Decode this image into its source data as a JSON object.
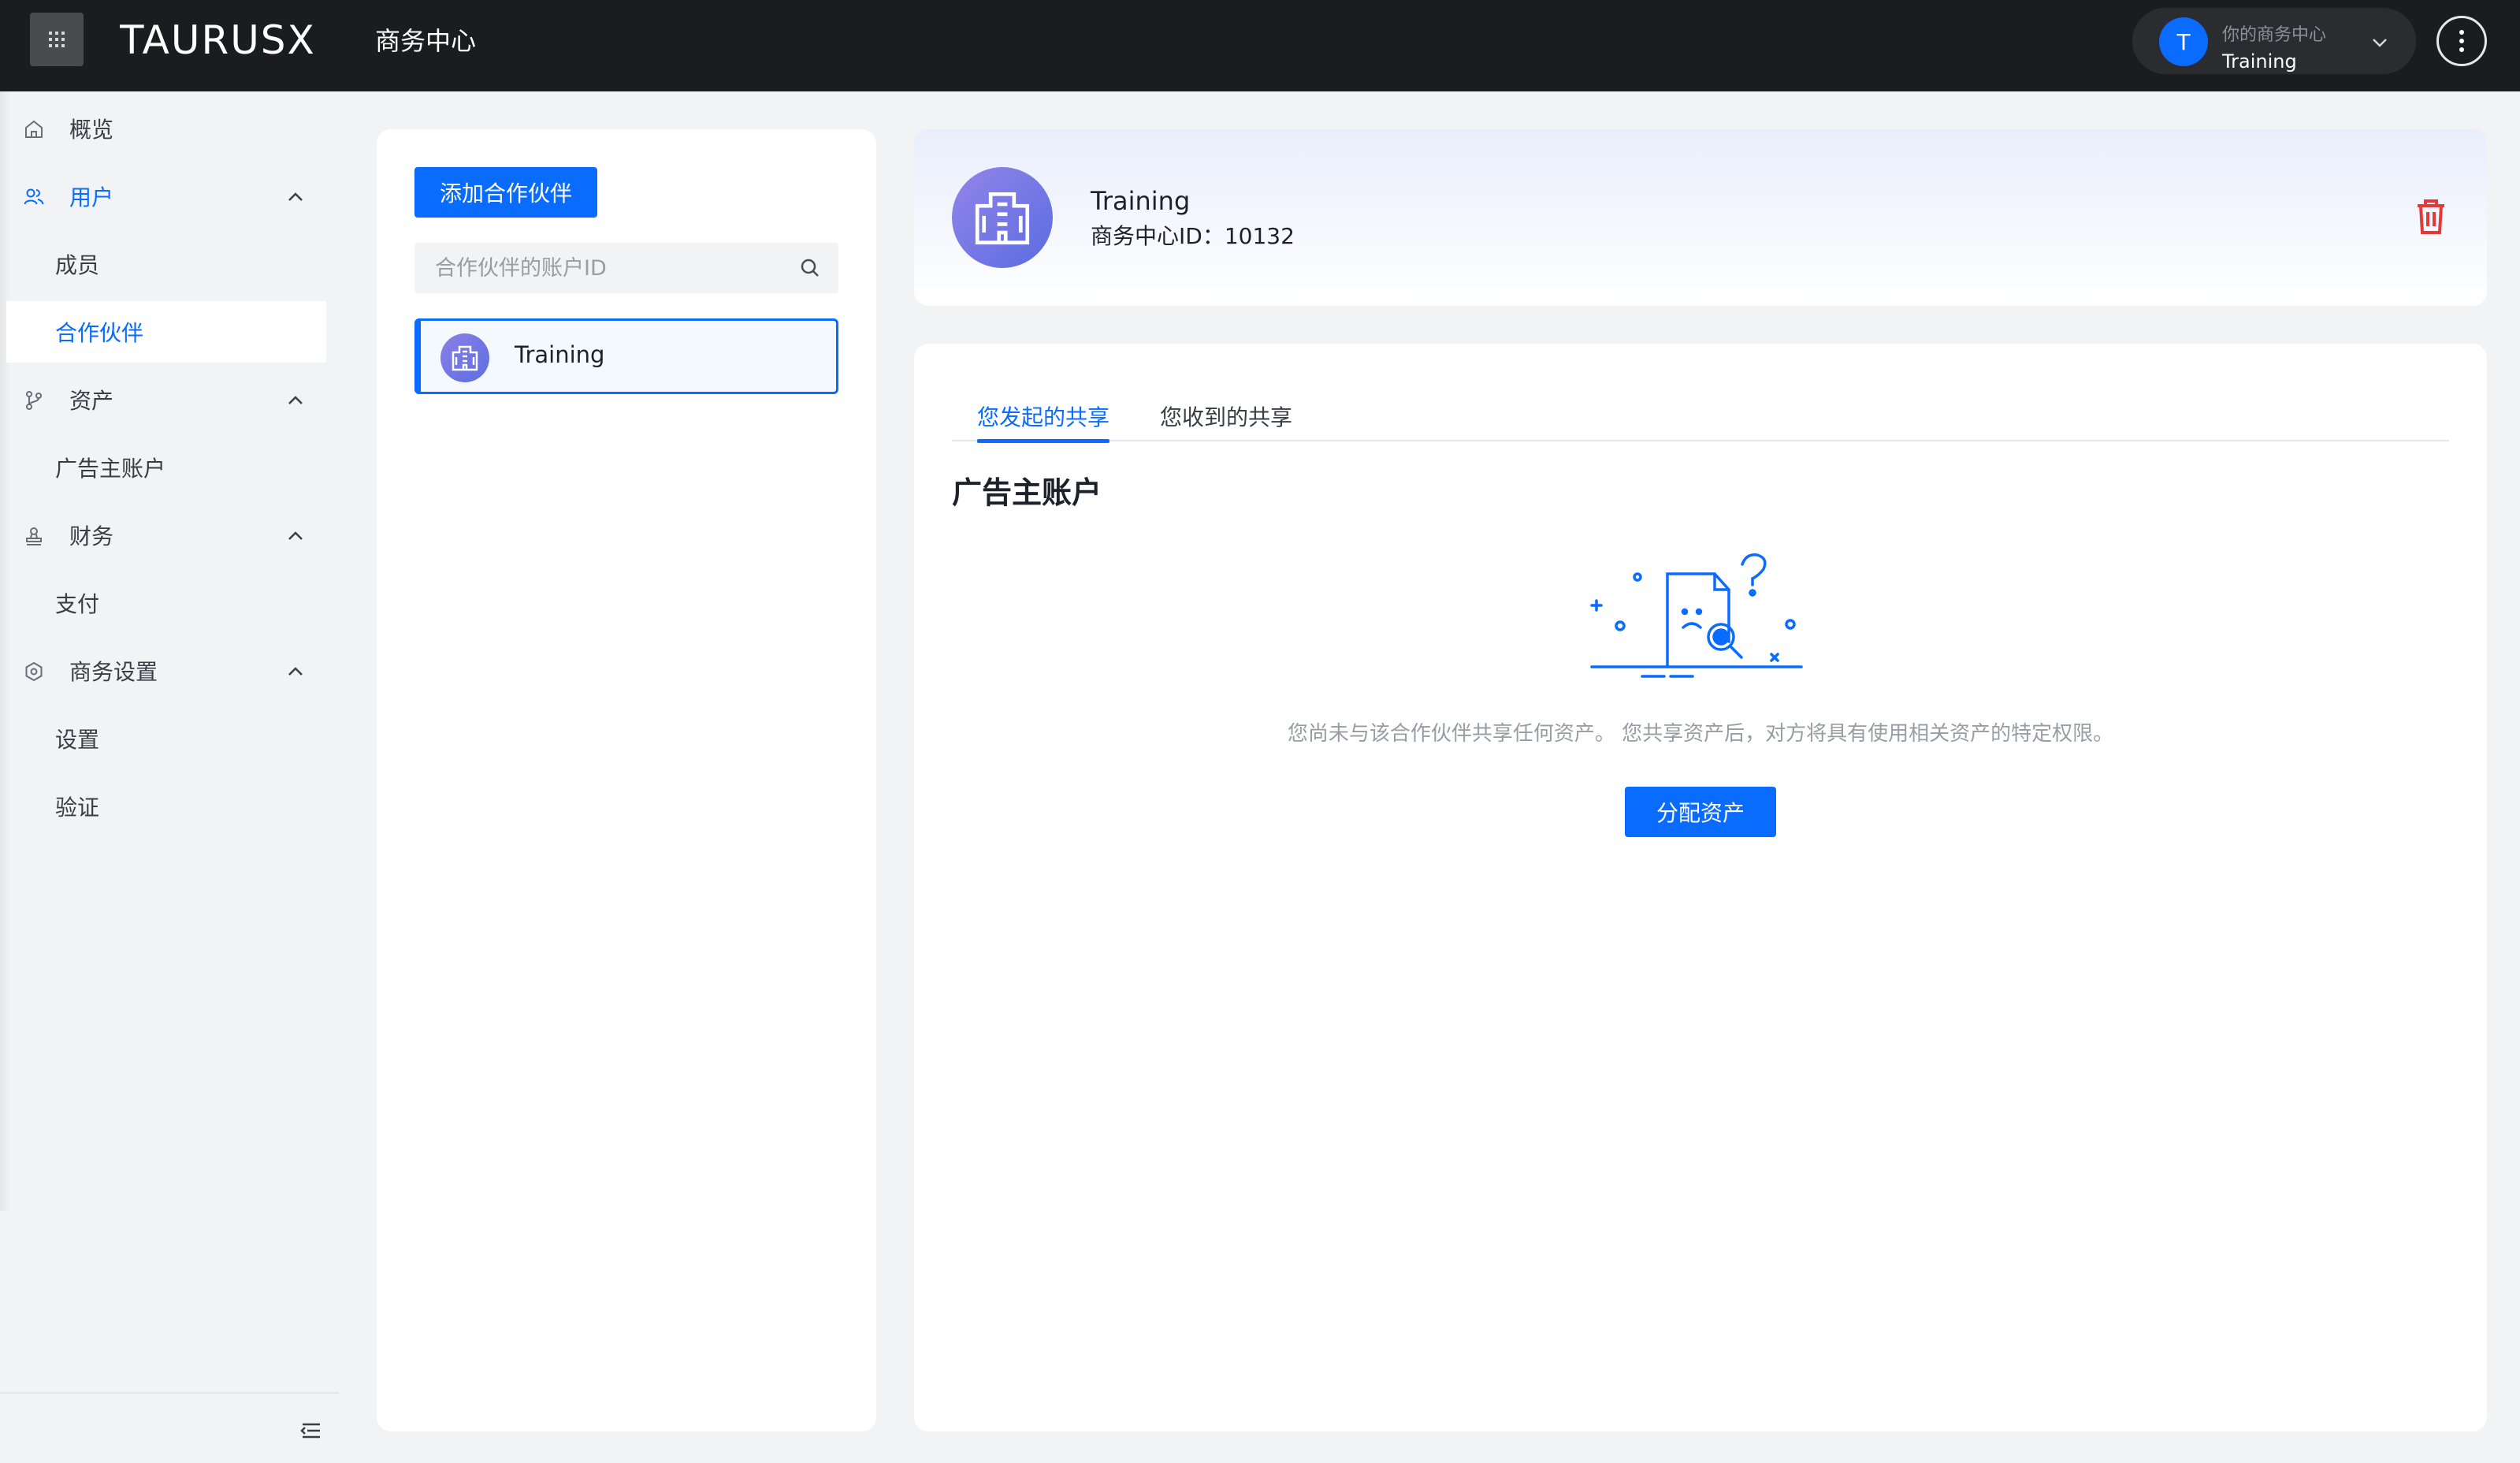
{
  "header": {
    "brand": "TAURUSX",
    "brand_sub": "商务中心",
    "account_label": "你的商务中心",
    "account_name": "Training",
    "account_initial": "T"
  },
  "sidebar": {
    "items": [
      {
        "label": "概览",
        "icon": "home-icon"
      },
      {
        "label": "用户",
        "icon": "users-icon",
        "expanded": true
      },
      {
        "label": "成员"
      },
      {
        "label": "合作伙伴",
        "active": true
      },
      {
        "label": "资产",
        "icon": "branch-icon",
        "expanded": true
      },
      {
        "label": "广告主账户"
      },
      {
        "label": "财务",
        "icon": "stamp-icon",
        "expanded": true
      },
      {
        "label": "支付"
      },
      {
        "label": "商务设置",
        "icon": "gear-icon",
        "expanded": true
      },
      {
        "label": "设置"
      },
      {
        "label": "验证"
      }
    ]
  },
  "partners": {
    "add_label": "添加合作伙伴",
    "search_placeholder": "合作伙伴的账户ID",
    "list": [
      {
        "name": "Training"
      }
    ]
  },
  "detail": {
    "name": "Training",
    "id_line": "商务中心ID：10132",
    "tabs": [
      {
        "label": "您发起的共享",
        "active": true
      },
      {
        "label": "您收到的共享",
        "active": false
      }
    ],
    "section_title": "广告主账户",
    "empty_text": "您尚未与该合作伙伴共享任何资产。 您共享资产后，对方将具有使用相关资产的特定权限。",
    "assign_label": "分配资产"
  },
  "colors": {
    "accent": "#0a6cff",
    "topbar": "#1b1c1f",
    "danger": "#e53935"
  }
}
